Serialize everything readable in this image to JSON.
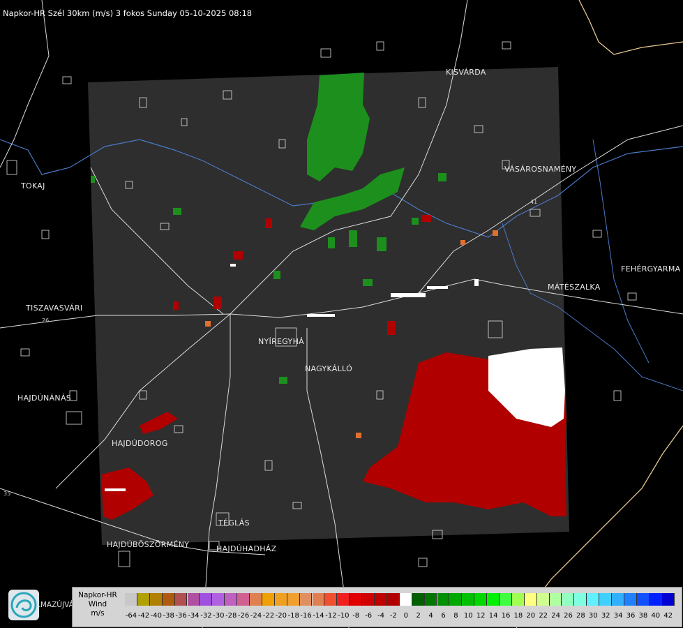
{
  "title": "Napkor-HR Szél 30km (m/s) 3 fokos Sunday 05-10-2025 08:18",
  "towns": [
    {
      "id": "kisvarda",
      "name": "KISVÁRDA"
    },
    {
      "id": "vasarosnameny",
      "name": "VÁSÁROSNAMÉNY"
    },
    {
      "id": "tokaj",
      "name": "TOKAJ"
    },
    {
      "id": "fehergyarmat",
      "name": "FEHÉRGYARMA"
    },
    {
      "id": "mateszalka",
      "name": "MÁTÉSZALKA"
    },
    {
      "id": "tiszavasvari",
      "name": "TISZAVASVÁRI"
    },
    {
      "id": "nyiregyhaza",
      "name": "NYÍREGYHÁ"
    },
    {
      "id": "nagykallo",
      "name": "NAGYKÁLLÓ"
    },
    {
      "id": "hajdunanas",
      "name": "HAJDÚNÁNÁS"
    },
    {
      "id": "hajdudorog",
      "name": "HAJDÚDOROG"
    },
    {
      "id": "teglas",
      "name": "TÉGLÁS"
    },
    {
      "id": "hajduboszormeny",
      "name": "HAJDÚBÖSZÖRMÉNY"
    },
    {
      "id": "hajduhadhaz",
      "name": "HAJDÚHADHÁZ"
    }
  ],
  "road_numbers": [
    "26",
    "35",
    "41"
  ],
  "legend": {
    "line1": "Napkor-HR",
    "line2": "Wind",
    "line3": "m/s",
    "ticks": [
      "-64",
      "-42",
      "-40",
      "-38",
      "-36",
      "-34",
      "-32",
      "-30",
      "-28",
      "-26",
      "-24",
      "-22",
      "-20",
      "-18",
      "-16",
      "-14",
      "-12",
      "-10",
      "-8",
      "-6",
      "-4",
      "-2",
      "0",
      "2",
      "4",
      "6",
      "8",
      "10",
      "12",
      "14",
      "16",
      "18",
      "20",
      "22",
      "24",
      "26",
      "28",
      "30",
      "32",
      "34",
      "36",
      "38",
      "40",
      "42"
    ],
    "colors": [
      "#c8c8c8",
      "#b0a000",
      "#b08000",
      "#b05a10",
      "#b05050",
      "#b050a0",
      "#a050e0",
      "#b060e0",
      "#c060c0",
      "#d06090",
      "#e08050",
      "#f0a000",
      "#f0a020",
      "#f0a030",
      "#e09060",
      "#e08050",
      "#f05030",
      "#f02020",
      "#e00000",
      "#d00000",
      "#c00000",
      "#b00000",
      "#ffffff",
      "#006000",
      "#007800",
      "#009000",
      "#00a800",
      "#00c000",
      "#00d800",
      "#00f000",
      "#40ff40",
      "#a0ff50",
      "#ffff80",
      "#d0ff90",
      "#b0ffa0",
      "#90ffc0",
      "#80ffe0",
      "#60f0ff",
      "#40d0ff",
      "#30b0ff",
      "#2080ff",
      "#1050ff",
      "#0020ff",
      "#0000d0"
    ]
  },
  "logo_text": "LMAZÚJVÁR"
}
